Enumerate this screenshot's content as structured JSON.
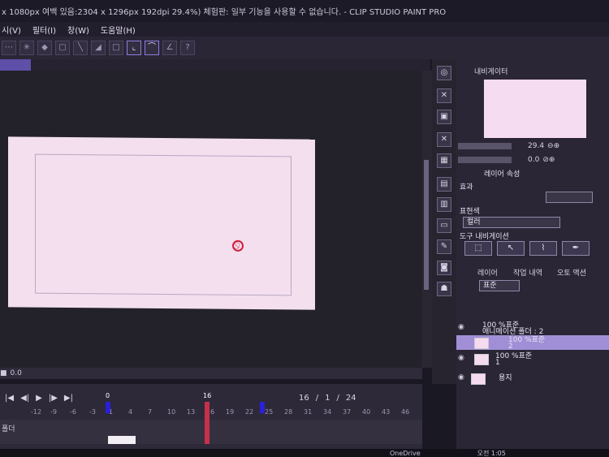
{
  "titlebar": {
    "text": "x 1080px 여백 있음:2304 x 1296px 192dpi 29.4%)  체험판: 일부 기능을 사용할 수 없습니다. - CLIP STUDIO PAINT PRO"
  },
  "menu": {
    "items": [
      "시(V)",
      "필터(I)",
      "창(W)",
      "도움말(H)"
    ]
  },
  "statusbar": {
    "zoom_value": "0.0"
  },
  "timeline": {
    "current_frame": "16",
    "slash1": "/",
    "frame_a": "1",
    "slash2": "/",
    "total_frames": "24",
    "ruler": [
      "-12",
      "-9",
      "-6",
      "-3",
      "1",
      "4",
      "7",
      "10",
      "13",
      "16",
      "19",
      "22",
      "25",
      "28",
      "31",
      "34",
      "37",
      "40",
      "43",
      "46"
    ],
    "marker_start": "0",
    "playhead_label": "16",
    "track_label": "폴더"
  },
  "navigator": {
    "tab_label": "내비게이터",
    "zoom": "29.4",
    "rotate": "0.0"
  },
  "properties": {
    "tab_label": "레이어 속성",
    "effect_label": "효과",
    "color_label": "표현색",
    "color_value": "컬러",
    "toolnav_label": "도구 내비게이션"
  },
  "layers": {
    "tab_label": "레이어",
    "tab2_label": "작업 내역",
    "tab3_label": "오토 액션",
    "blend_mode": "표준",
    "rows": [
      {
        "line1": "100 %표준",
        "line2": "애니메이션 폴더 : 2"
      },
      {
        "line1": "100 %표준",
        "line2": "2"
      },
      {
        "line1": "100 %표준",
        "line2": "1"
      },
      {
        "line1": "용지",
        "line2": ""
      }
    ]
  },
  "taskbar": {
    "onedrive": "OneDrive",
    "clock": "오전 1:05"
  },
  "colors": {
    "accent": "#8c7fe0",
    "playhead": "#c6304a",
    "marker": "#2a20d8",
    "selected_layer": "#a08fd6",
    "paper": "#f3dfee"
  }
}
